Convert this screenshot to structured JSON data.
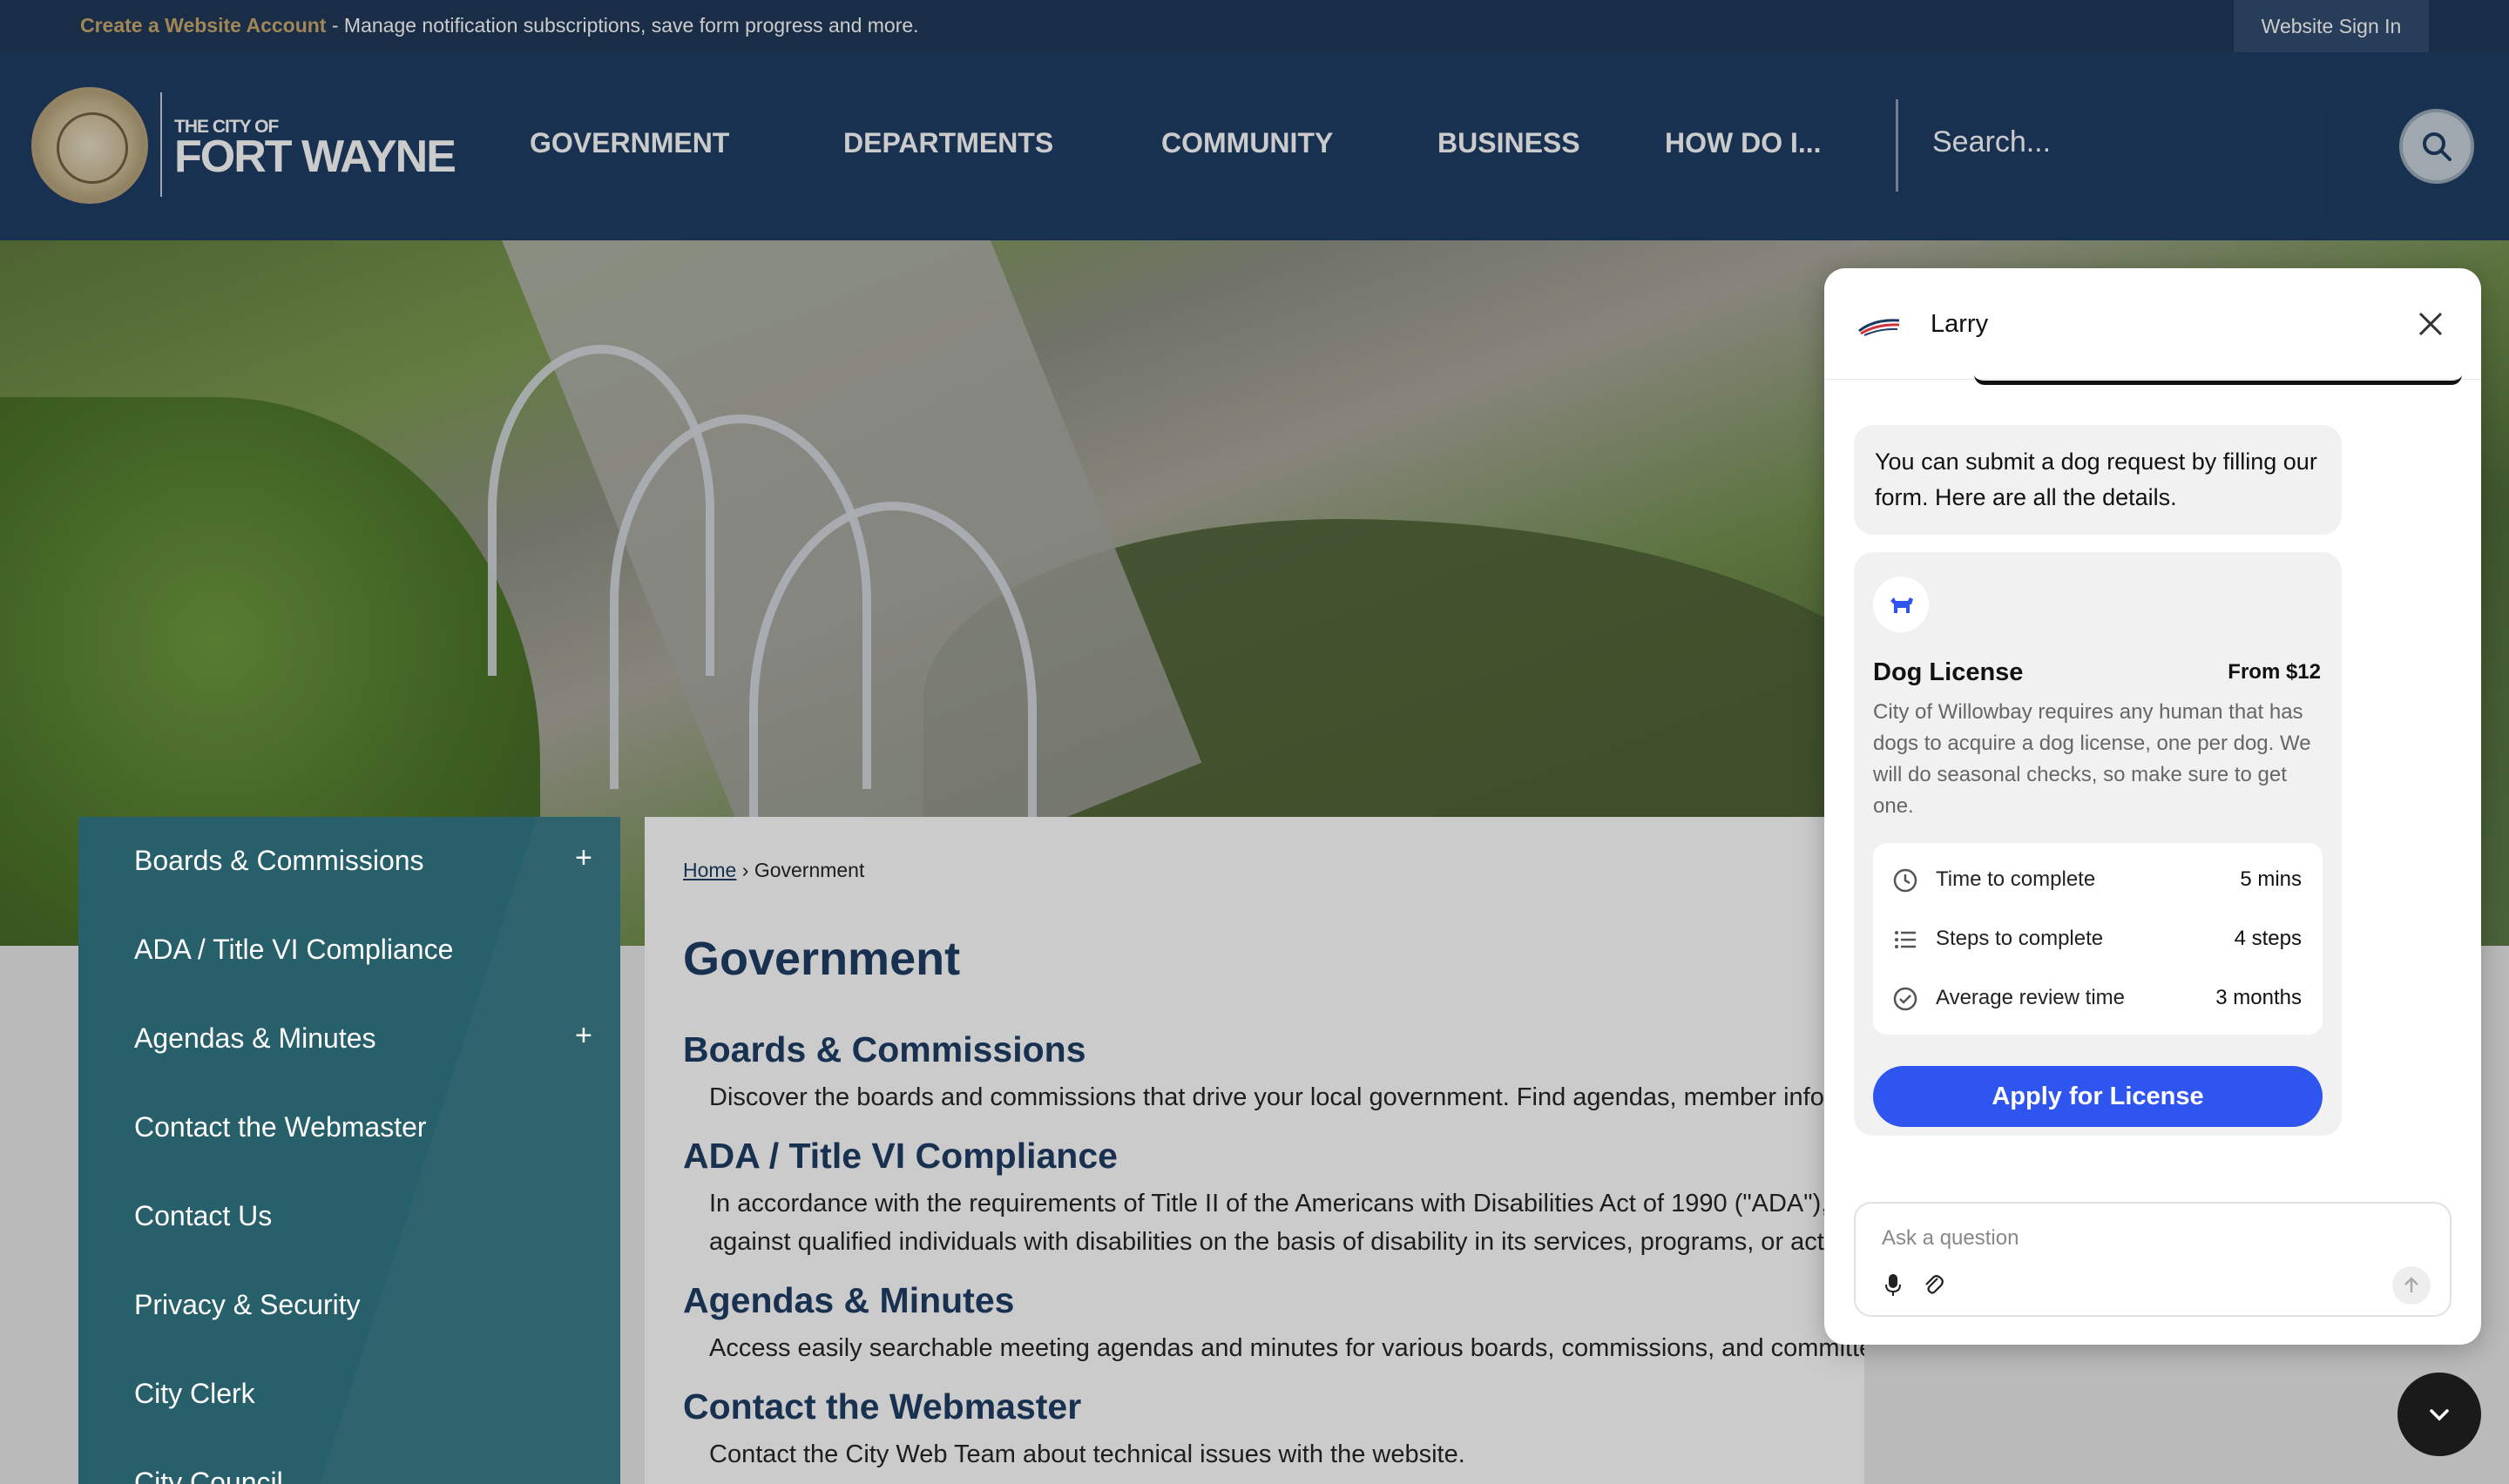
{
  "utility": {
    "create_link": "Create a Website Account",
    "create_rest": " - Manage notification subscriptions, save form progress and more.",
    "signin": "Website Sign In"
  },
  "header": {
    "logo_small": "THE CITY OF",
    "logo_big": "FORT WAYNE",
    "nav": [
      "GOVERNMENT",
      "DEPARTMENTS",
      "COMMUNITY",
      "BUSINESS",
      "HOW DO I..."
    ],
    "search_placeholder": "Search..."
  },
  "sidebar": {
    "items": [
      {
        "label": "Boards & Commissions",
        "expandable": "+"
      },
      {
        "label": "ADA / Title VI Compliance",
        "expandable": ""
      },
      {
        "label": "Agendas & Minutes",
        "expandable": "+"
      },
      {
        "label": "Contact the Webmaster",
        "expandable": ""
      },
      {
        "label": "Contact Us",
        "expandable": ""
      },
      {
        "label": "Privacy & Security",
        "expandable": ""
      },
      {
        "label": "City Clerk",
        "expandable": ""
      },
      {
        "label": "City Council",
        "expandable": ""
      }
    ]
  },
  "content": {
    "breadcrumb_home": "Home",
    "breadcrumb_sep": " › ",
    "breadcrumb_current": "Government",
    "title": "Government",
    "sections": [
      {
        "title": "Boards & Commissions",
        "lines": [
          "Discover the boards and commissions that drive your local government. Find agendas, member information, and more."
        ]
      },
      {
        "title": "ADA / Title VI Compliance",
        "lines": [
          "In accordance with the requirements of Title II of the Americans with Disabilities Act of 1990 (\"ADA\"), the City will not discriminate",
          "against qualified individuals with disabilities on the basis of disability in its services, programs, or activities."
        ]
      },
      {
        "title": "Agendas & Minutes",
        "lines": [
          "Access easily searchable meeting agendas and minutes for various boards, commissions, and committees."
        ]
      },
      {
        "title": "Contact the Webmaster",
        "lines": [
          "Contact the City Web Team about technical issues with the website."
        ]
      }
    ]
  },
  "chat": {
    "bot_name": "Larry",
    "message": "You can submit a dog request by filling our form. Here are all the details.",
    "card": {
      "icon": "dog-icon",
      "title": "Dog License",
      "price": "From $12",
      "description": "City of Willowbay requires any human that has dogs to acquire a dog license, one per dog. We will do seasonal checks, so make sure to get one.",
      "stats": [
        {
          "icon": "clock-icon",
          "label": "Time to complete",
          "value": "5 mins"
        },
        {
          "icon": "list-icon",
          "label": "Steps to complete",
          "value": "4 steps"
        },
        {
          "icon": "check-circle-icon",
          "label": "Average review time",
          "value": "3 months"
        }
      ],
      "apply_label": "Apply for License"
    },
    "input_placeholder": "Ask a question",
    "accent": "#2f55f0"
  }
}
